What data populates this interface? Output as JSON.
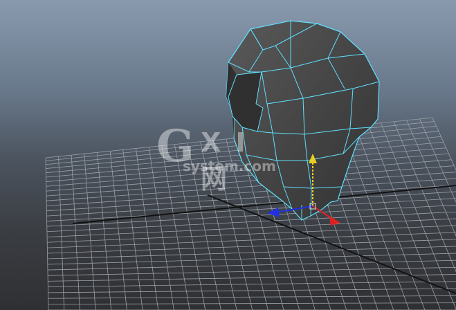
{
  "viewport": {
    "background_top": "#8a9aae",
    "background_bottom": "#2f3033",
    "grid_color": "#9aa0a8",
    "axis_color": "#121212",
    "wireframe_color": "#5fe0ff",
    "mesh_fill": "#4a4a4a"
  },
  "gizmo": {
    "x_axis_color": "#e02020",
    "y_axis_color": "#e8d020",
    "z_axis_color": "#2030e0"
  },
  "watermark": {
    "mark": "G",
    "brand": "X I 网",
    "site": "system.com"
  }
}
